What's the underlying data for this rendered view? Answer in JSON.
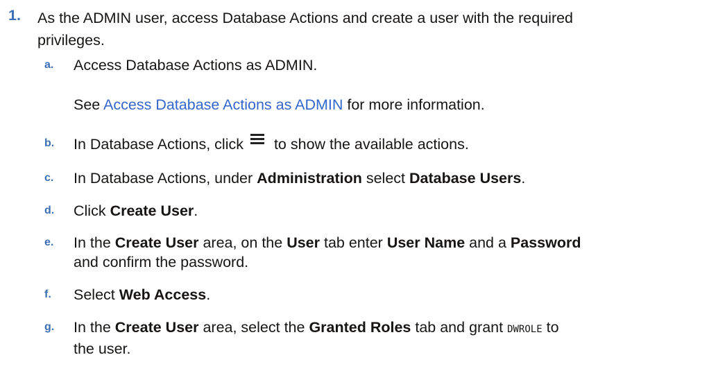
{
  "step": {
    "number": "1.",
    "text_line1": "As the ADMIN user, access Database Actions and create a user with the required",
    "text_line2": "privileges."
  },
  "substeps": {
    "a": {
      "letter": "a.",
      "text": "Access Database Actions as ADMIN."
    },
    "note": {
      "prefix": "See ",
      "link": "Access Database Actions as ADMIN",
      "suffix": " for more information."
    },
    "b": {
      "letter": "b.",
      "before": "In Database Actions, click",
      "icon": "hamburger-menu-icon",
      "after": "to show the available actions."
    },
    "c": {
      "letter": "c.",
      "t1": "In Database Actions, under ",
      "b1": "Administration",
      "t2": " select ",
      "b2": "Database Users",
      "t3": "."
    },
    "d": {
      "letter": "d.",
      "t1": "Click ",
      "b1": "Create User",
      "t2": "."
    },
    "e": {
      "letter": "e.",
      "t1": "In the ",
      "b1": "Create User",
      "t2": " area, on the ",
      "b2": "User",
      "t3": " tab enter ",
      "b3": "User Name",
      "t4": " and a ",
      "b4": "Password",
      "line2": "and confirm the password."
    },
    "f": {
      "letter": "f.",
      "t1": "Select ",
      "b1": "Web Access",
      "t2": "."
    },
    "g": {
      "letter": "g.",
      "t1": "In the ",
      "b1": "Create User",
      "t2": " area, select the ",
      "b2": "Granted Roles",
      "t3": " tab and grant ",
      "code": "DWROLE",
      "t4": " to",
      "line2": "the user."
    }
  },
  "colors": {
    "accent": "#3b6fb6",
    "link": "#3366cc",
    "text": "#161513"
  }
}
